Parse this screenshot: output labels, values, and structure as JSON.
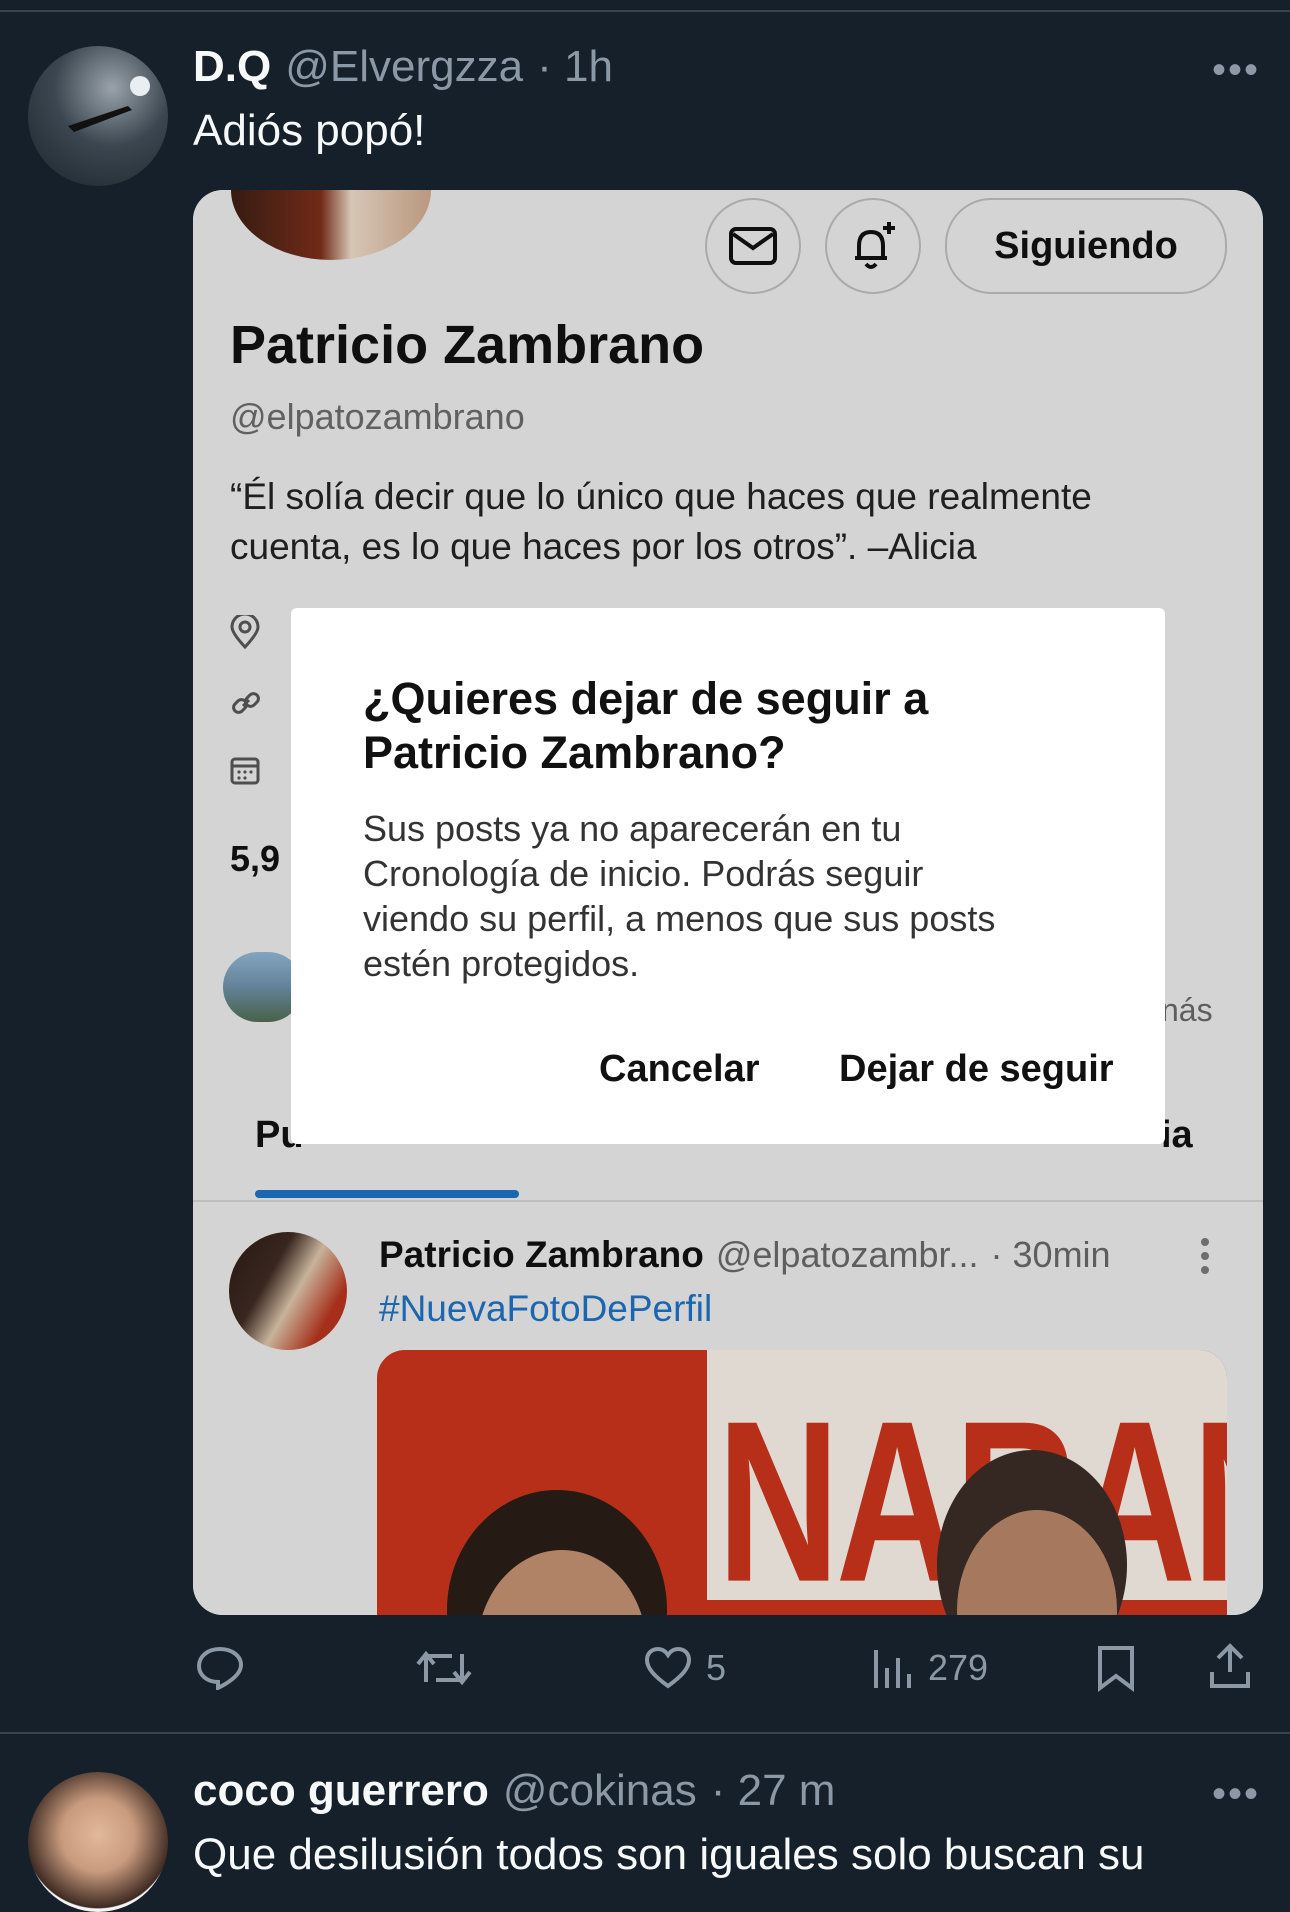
{
  "tweet1": {
    "name": "D.Q",
    "handle": "@Elvergzza",
    "time": "· 1h",
    "text": "Adiós popó!",
    "more": "•••"
  },
  "embedded_profile": {
    "follow_button": "Siguiendo",
    "name": "Patricio Zambrano",
    "handle": "@elpatozambrano",
    "bio_line1": "“Él solía decir que lo único que haces que realmente",
    "bio_line2": "cuenta, es lo que haces por los otros”. –Alicia",
    "count_partial": "5,9",
    "more_partial": "nás",
    "tab_left_partial": "Pu",
    "tab_right_partial": "ia"
  },
  "dialog": {
    "title_line1": "¿Quieres dejar de seguir a",
    "title_line2": "Patricio Zambrano?",
    "body_line1": "Sus posts ya no aparecerán en tu",
    "body_line2": "Cronología de inicio. Podrás seguir",
    "body_line3": "viendo su perfil, a menos que sus posts",
    "body_line4": "estén protegidos.",
    "cancel": "Cancelar",
    "confirm": "Dejar de seguir"
  },
  "inner_post": {
    "name": "Patricio Zambrano",
    "handle": "@elpatozambr...",
    "time": "· 30min",
    "hashtag": "#NuevaFotoDePerfil",
    "image_text": "NARANJ"
  },
  "actions": {
    "likes": "5",
    "views": "279"
  },
  "tweet2": {
    "name": "coco guerrero",
    "handle": "@cokinas",
    "time": "· 27 m",
    "text": "Que desilusión todos son iguales solo buscan su",
    "more": "•••"
  },
  "colors": {
    "background": "#15202b",
    "link_blue": "#1d6fbf",
    "tab_indicator": "#1d6fbf",
    "modal_bg": "#ffffff"
  }
}
